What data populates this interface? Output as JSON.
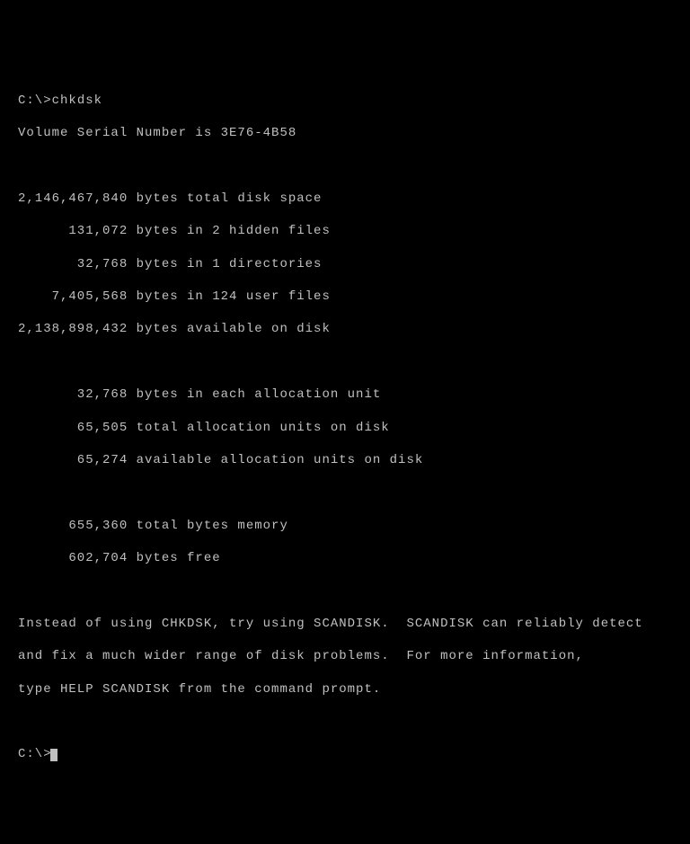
{
  "terminal": {
    "prompt1": "C:\\>",
    "command": "chkdsk",
    "volume_serial_line": "Volume Serial Number is 3E76-4B58",
    "rows": [
      "2,146,467,840 bytes total disk space",
      "      131,072 bytes in 2 hidden files",
      "       32,768 bytes in 1 directories",
      "    7,405,568 bytes in 124 user files",
      "2,138,898,432 bytes available on disk",
      "",
      "       32,768 bytes in each allocation unit",
      "       65,505 total allocation units on disk",
      "       65,274 available allocation units on disk",
      "",
      "      655,360 total bytes memory",
      "      602,704 bytes free"
    ],
    "advice1": "Instead of using CHKDSK, try using SCANDISK.  SCANDISK can reliably detect",
    "advice2": "and fix a much wider range of disk problems.  For more information,",
    "advice3": "type HELP SCANDISK from the command prompt.",
    "prompt2": "C:\\>"
  }
}
